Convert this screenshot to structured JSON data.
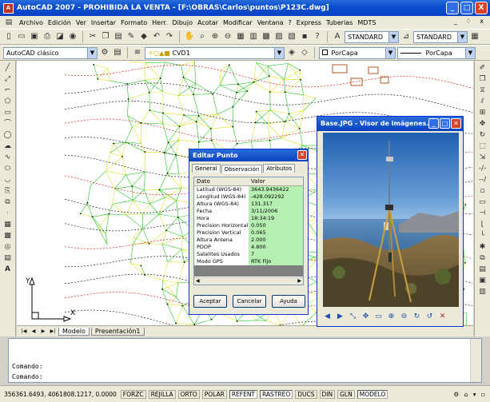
{
  "window": {
    "title": "AutoCAD 2007 - PROHIBIDA LA VENTA - [F:\\OBRAS\\Carlos\\puntos\\P123C.dwg]",
    "controls": [
      "_",
      "□",
      "X"
    ]
  },
  "menubar": {
    "items": [
      "Archivo",
      "Edición",
      "Ver",
      "Insertar",
      "Formato",
      "Herr.",
      "Dibujo",
      "Acotar",
      "Modificar",
      "Ventana",
      "?",
      "Express",
      "Tuberias",
      "MDTS"
    ],
    "mdi_controls": "_ ♢ x"
  },
  "toolbar1": {
    "text_style": "STANDARD",
    "dim_style": "STANDARD"
  },
  "toolbar2": {
    "workspace": "AutoCAD clásico",
    "layer": "CVD1",
    "color": "PorCapa",
    "linetype": "PorCapa"
  },
  "model_tabs": [
    "Modelo",
    "Presentación1"
  ],
  "ucs": {
    "y": "Y",
    "x": "X"
  },
  "command": {
    "history": "Comando:",
    "prompt": "Comando:"
  },
  "statusbar": {
    "coords": "356361.6493, 4061808.1217, 0.0000",
    "toggles": [
      {
        "label": "FORZC",
        "on": false
      },
      {
        "label": "REJILLA",
        "on": false
      },
      {
        "label": "ORTO",
        "on": false
      },
      {
        "label": "POLAR",
        "on": false
      },
      {
        "label": "REFENT",
        "on": true
      },
      {
        "label": "RASTREO",
        "on": true
      },
      {
        "label": "DUCS",
        "on": false
      },
      {
        "label": "DIN",
        "on": false
      },
      {
        "label": "GLN",
        "on": false
      },
      {
        "label": "MODELO",
        "on": true
      }
    ]
  },
  "dialog": {
    "title": "Editar Punto",
    "tabs": [
      "General",
      "Observación",
      "Atributos"
    ],
    "selected_tab": "Observación",
    "columns": [
      "Dato",
      "Valor"
    ],
    "rows": [
      {
        "k": "Latitud (WGS-84)",
        "v": "3643.9436422"
      },
      {
        "k": "Longitud (WGS-84)",
        "v": "-428.092292"
      },
      {
        "k": "Altura (WGS-84)",
        "v": "131.317"
      },
      {
        "k": "Fecha",
        "v": "3/11/2006"
      },
      {
        "k": "Hora",
        "v": "18:34:19"
      },
      {
        "k": "Precision Horizontal",
        "v": "0.050"
      },
      {
        "k": "Precision Vertical",
        "v": "0.065"
      },
      {
        "k": "Altura Antena",
        "v": "2.000"
      },
      {
        "k": "PDOP",
        "v": "4.800"
      },
      {
        "k": "Satelites Usados",
        "v": "7"
      },
      {
        "k": "Modo GPS",
        "v": "RTK Fijo"
      }
    ],
    "buttons": {
      "ok": "Aceptar",
      "cancel": "Cancelar",
      "help": "Ayuda"
    }
  },
  "viewer": {
    "title": "Base.JPG - Visor de imágenes..."
  },
  "colors": {
    "xp_blue": "#0843c0",
    "mesh_green": "#22c822",
    "mesh_yellow": "#e0e020",
    "value_bg": "#b6f0b0"
  }
}
